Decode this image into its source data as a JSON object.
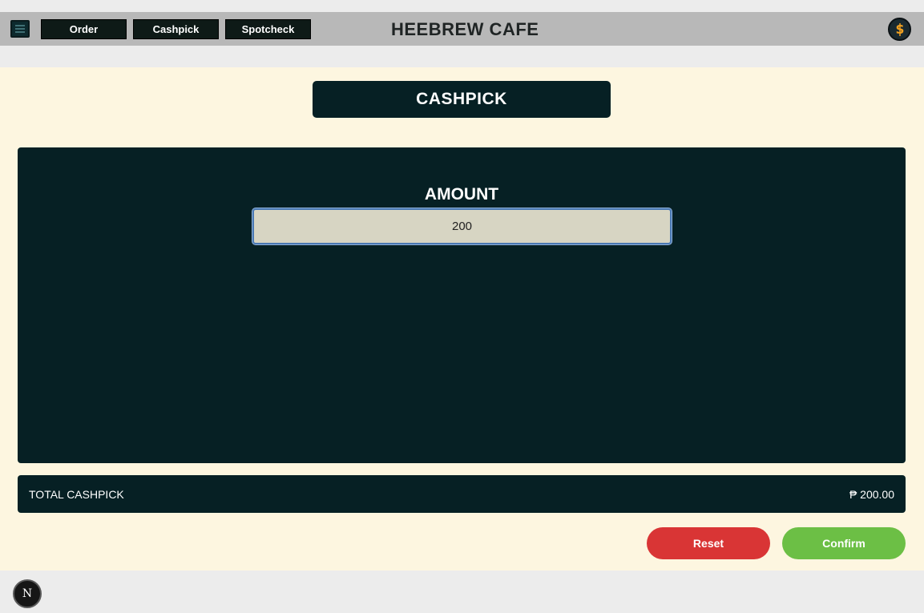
{
  "header": {
    "menu_icon": "hamburger-menu-icon",
    "nav": [
      {
        "label": "Order"
      },
      {
        "label": "Cashpick"
      },
      {
        "label": "Spotcheck"
      }
    ],
    "brand": "HEEBREW CAFE",
    "corner_icon": "coin-currency-icon"
  },
  "page": {
    "title": "CASHPICK",
    "amount_label": "AMOUNT",
    "amount_value": "200",
    "total_label": "TOTAL CASHPICK",
    "total_value": "₱ 200.00",
    "reset_label": "Reset",
    "confirm_label": "Confirm"
  },
  "footer": {
    "badge_letter": "N",
    "badge_icon": "nextjs-logo-icon"
  },
  "colors": {
    "panel": "#062024",
    "reset": "#d93535",
    "confirm": "#6cbf45",
    "background": "#fdf6e0"
  }
}
